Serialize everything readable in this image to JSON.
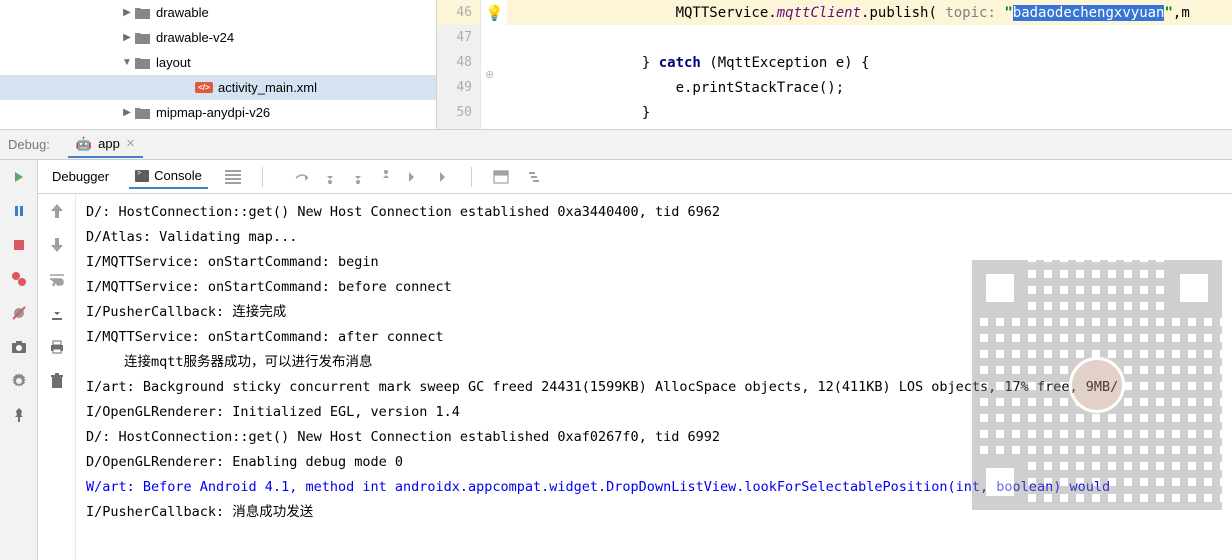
{
  "tree": {
    "items": [
      {
        "label": "drawable",
        "indent": "indent-1",
        "arrow": "▶",
        "selected": false
      },
      {
        "label": "drawable-v24",
        "indent": "indent-1",
        "arrow": "▶",
        "selected": false
      },
      {
        "label": "layout",
        "indent": "indent-1",
        "arrow": "▼",
        "selected": false
      },
      {
        "label": "activity_main.xml",
        "indent": "indent-3",
        "arrow": "",
        "selected": true,
        "xml": true
      },
      {
        "label": "mipmap-anydpi-v26",
        "indent": "indent-1",
        "arrow": "▶",
        "selected": false
      }
    ]
  },
  "gutter": [
    "46",
    "47",
    "48",
    "49",
    "50"
  ],
  "code": {
    "line46": {
      "indent": "                    ",
      "part1": "MQTTService.",
      "field": "mqttClient",
      "part2": ".publish(",
      "param": " topic: ",
      "quote1": "\"",
      "sel": "badaodechengxvyuan",
      "quote2": "\"",
      "part3": ",m"
    },
    "line48": {
      "indent": "                } ",
      "kw": "catch",
      "rest": " (MqttException e) {"
    },
    "line49": "                    e.printStackTrace();",
    "line50": "                }"
  },
  "debug": {
    "title": "Debug:",
    "tab": "app",
    "tabs": {
      "debugger": "Debugger",
      "console": "Console"
    }
  },
  "console": [
    {
      "cls": "",
      "text": "D/: HostConnection::get() New Host Connection established 0xa3440400, tid 6962"
    },
    {
      "cls": "",
      "text": "D/Atlas: Validating map..."
    },
    {
      "cls": "",
      "text": "I/MQTTService: onStartCommand: begin"
    },
    {
      "cls": "",
      "text": "I/MQTTService: onStartCommand: before connect"
    },
    {
      "cls": "",
      "text": "I/PusherCallback: 连接完成"
    },
    {
      "cls": "",
      "text": "I/MQTTService: onStartCommand: after connect"
    },
    {
      "cls": "log-indent",
      "text": "连接mqtt服务器成功，可以进行发布消息"
    },
    {
      "cls": "",
      "text": "I/art: Background sticky concurrent mark sweep GC freed 24431(1599KB) AllocSpace objects, 12(411KB) LOS objects, 17% free, 9MB/"
    },
    {
      "cls": "",
      "text": "I/OpenGLRenderer: Initialized EGL, version 1.4"
    },
    {
      "cls": "",
      "text": "D/: HostConnection::get() New Host Connection established 0xaf0267f0, tid 6992"
    },
    {
      "cls": "",
      "text": "D/OpenGLRenderer: Enabling debug mode 0"
    },
    {
      "cls": "warn",
      "text": "W/art: Before Android 4.1, method int androidx.appcompat.widget.DropDownListView.lookForSelectablePosition(int, boolean) would"
    },
    {
      "cls": "",
      "text": "I/PusherCallback: 消息成功发送"
    }
  ]
}
